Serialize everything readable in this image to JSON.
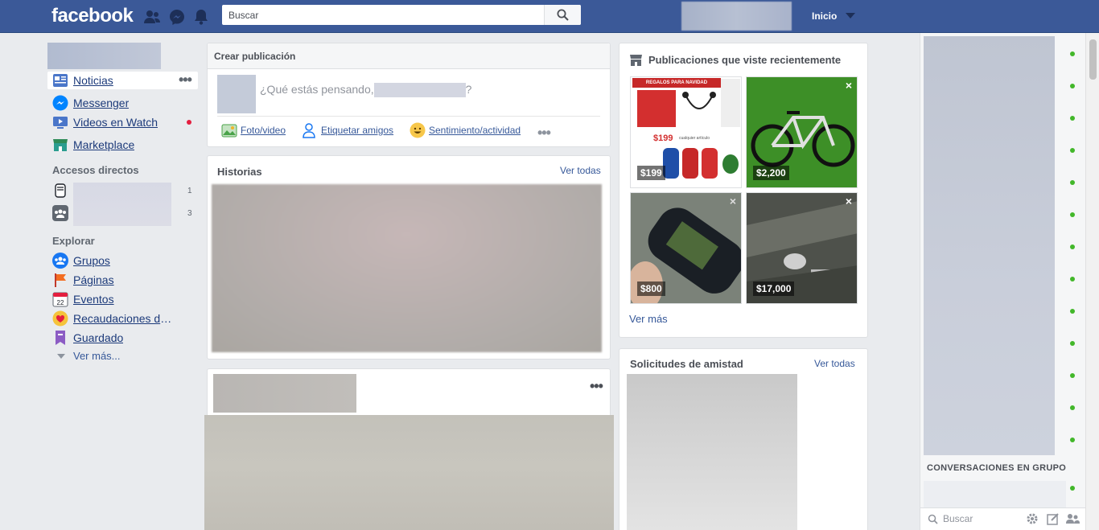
{
  "header": {
    "logo": "facebook",
    "search_placeholder": "Buscar",
    "home_label": "Inicio"
  },
  "left_nav": {
    "items": [
      {
        "label": "Noticias"
      },
      {
        "label": "Messenger"
      },
      {
        "label": "Videos en Watch"
      },
      {
        "label": "Marketplace"
      }
    ],
    "shortcuts_title": "Accesos directos",
    "shortcut_counts": [
      "1",
      "3"
    ],
    "explore_title": "Explorar",
    "explore_items": [
      {
        "label": "Grupos"
      },
      {
        "label": "Páginas"
      },
      {
        "label": "Eventos"
      },
      {
        "label": "Recaudaciones de ..."
      },
      {
        "label": "Guardado"
      }
    ],
    "see_more": "Ver más..."
  },
  "composer": {
    "title": "Crear publicación",
    "prompt_prefix": "¿Qué estás pensando,",
    "prompt_suffix": "?",
    "actions": [
      {
        "label": "Foto/video"
      },
      {
        "label": "Etiquetar amigos"
      },
      {
        "label": "Sentimiento/actividad"
      }
    ]
  },
  "stories": {
    "title": "Historias",
    "see_all": "Ver todas"
  },
  "recent": {
    "title": "Publicaciones que viste recientemente",
    "items": [
      {
        "price": "$199",
        "banner": "REGALOS PARA NAVIDAD",
        "promo": "$199",
        "promo_sub": "cualquier artículo"
      },
      {
        "price": "$2,200"
      },
      {
        "price": "$800"
      },
      {
        "price": "$17,000"
      }
    ],
    "see_more": "Ver más"
  },
  "friend_requests": {
    "title": "Solicitudes de amistad",
    "see_all": "Ver todas"
  },
  "chat": {
    "group_title": "CONVERSACIONES EN GRUPO",
    "search_label": "Buscar"
  },
  "colors": {
    "brand": "#3b5998",
    "link": "#365899",
    "online": "#42b72a",
    "notification": "#e41e3f"
  }
}
